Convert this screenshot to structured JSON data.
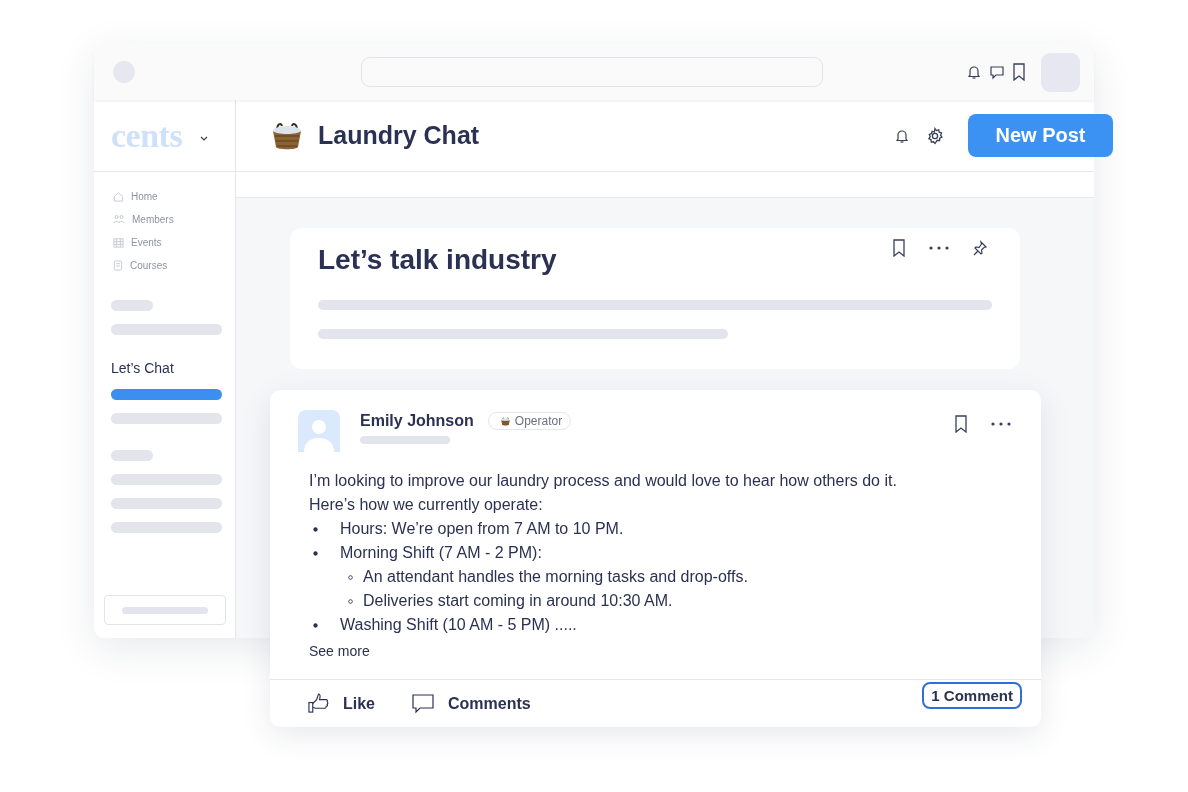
{
  "sidebar": {
    "logo": "cents",
    "nav": [
      {
        "label": "Home"
      },
      {
        "label": "Members"
      },
      {
        "label": "Events"
      },
      {
        "label": "Courses"
      }
    ],
    "section_title": "Let’s Chat",
    "chat_items": [
      {
        "selected": true
      },
      {
        "selected": false
      }
    ]
  },
  "header": {
    "title": "Laundry Chat",
    "button": "New Post"
  },
  "topic": {
    "title": "Let’s talk industry"
  },
  "post": {
    "author": "Emily Johnson",
    "badge": "Operator",
    "intro": [
      "I’m looking to improve our laundry process and would love to hear how others do it.",
      "Here’s how we currently operate:"
    ],
    "bullets": [
      {
        "text": "Hours: We’re open from 7 AM to 10 PM."
      },
      {
        "text": "Morning Shift (7 AM - 2 PM):",
        "children": [
          {
            "text": "An attendant handles the morning tasks and drop-offs."
          },
          {
            "text": "Deliveries start coming in around 10:30 AM."
          }
        ]
      },
      {
        "text": "Washing Shift (10 AM - 5 PM) ....."
      }
    ],
    "see_more": "See more",
    "actions": [
      {
        "kind": "like",
        "label": "Like"
      },
      {
        "kind": "comments",
        "label": "Comments"
      }
    ],
    "comment_count": "1 Comment"
  }
}
